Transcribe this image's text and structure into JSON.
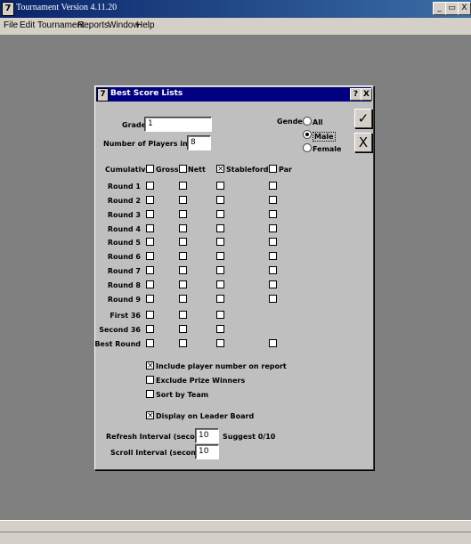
{
  "window": {
    "title": "Tournament Version 4.11.20"
  },
  "caption_buttons": {
    "minimize": "_",
    "restore": "▭",
    "close": "X"
  },
  "menu": [
    "File",
    "Edit",
    "Tournament",
    "Reports",
    "Window",
    "Help"
  ],
  "dialog": {
    "icon_glyph": "7",
    "title": "Best Score Lists",
    "help_glyph": "?",
    "close_glyph": "X",
    "grade_label": "Grade",
    "grade_value": "1",
    "players_label": "Number of Players in List",
    "players_value": "8",
    "gender": {
      "label": "Gender",
      "options": [
        "All",
        "Male",
        "Female"
      ],
      "selected": "Male"
    },
    "ok_glyph": "✓",
    "cancel_glyph": "X",
    "columns": [
      "Gross",
      "Nett",
      "Stableford",
      "Par"
    ],
    "cumulative_label": "Cumulative",
    "cumulative_checked": [
      false,
      false,
      true,
      false
    ],
    "rows": [
      {
        "label": "Round 1",
        "boxes": [
          true,
          true,
          true,
          true
        ]
      },
      {
        "label": "Round 2",
        "boxes": [
          true,
          true,
          true,
          true
        ]
      },
      {
        "label": "Round 3",
        "boxes": [
          true,
          true,
          true,
          true
        ]
      },
      {
        "label": "Round 4",
        "boxes": [
          true,
          true,
          true,
          true
        ]
      },
      {
        "label": "Round 5",
        "boxes": [
          true,
          true,
          true,
          true
        ]
      },
      {
        "label": "Round 6",
        "boxes": [
          true,
          true,
          true,
          true
        ]
      },
      {
        "label": "Round 7",
        "boxes": [
          true,
          true,
          true,
          true
        ]
      },
      {
        "label": "Round 8",
        "boxes": [
          true,
          true,
          true,
          true
        ]
      },
      {
        "label": "Round 9",
        "boxes": [
          true,
          true,
          true,
          true
        ]
      },
      {
        "label": "First 36",
        "boxes": [
          true,
          true,
          true,
          false
        ]
      },
      {
        "label": "Second  36",
        "boxes": [
          true,
          true,
          true,
          false
        ]
      },
      {
        "label": "Best Round",
        "boxes": [
          true,
          true,
          true,
          true
        ]
      }
    ],
    "options": [
      {
        "label": "Include player number on report",
        "checked": true
      },
      {
        "label": "Exclude Prize Winners",
        "checked": false
      },
      {
        "label": "Sort by Team",
        "checked": false
      },
      {
        "label": "Display on Leader Board",
        "checked": true
      }
    ],
    "refresh_label": "Refresh Interval (seconds)",
    "refresh_value": "10",
    "suggest_text": "Suggest 0/10",
    "scroll_label": "Scroll Interval (seconds)",
    "scroll_value": "10"
  }
}
